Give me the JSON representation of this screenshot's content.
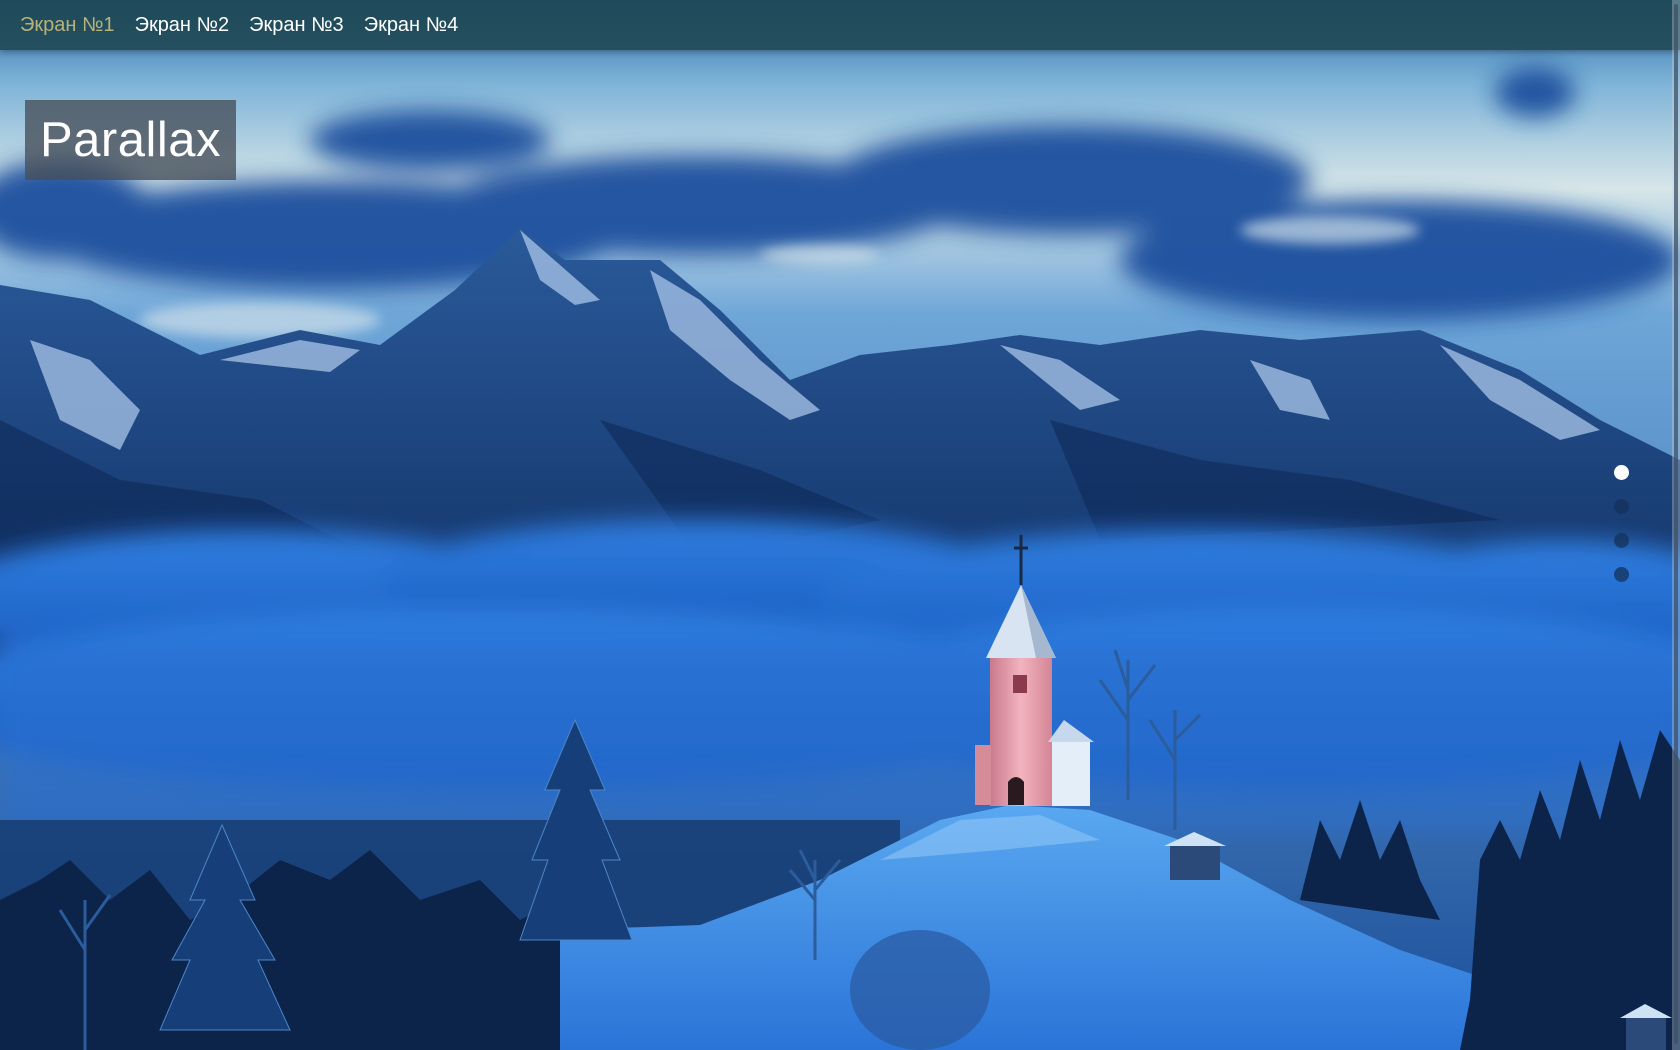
{
  "nav": {
    "items": [
      {
        "label": "Экран №1",
        "active": true
      },
      {
        "label": "Экран №2",
        "active": false
      },
      {
        "label": "Экран №3",
        "active": false
      },
      {
        "label": "Экран №4",
        "active": false
      }
    ],
    "active_color": "#b8b27a"
  },
  "hero": {
    "title": "Parallax"
  },
  "pager": {
    "count": 4,
    "active_index": 0
  },
  "colors": {
    "sky_top": "#b9d6e6",
    "cloud_blue": "#1f5fb0",
    "mountain": "#1a3f78",
    "snow": "#3d8ee8",
    "navbar": "#1e4650",
    "church_wall": "#e89aa8"
  }
}
